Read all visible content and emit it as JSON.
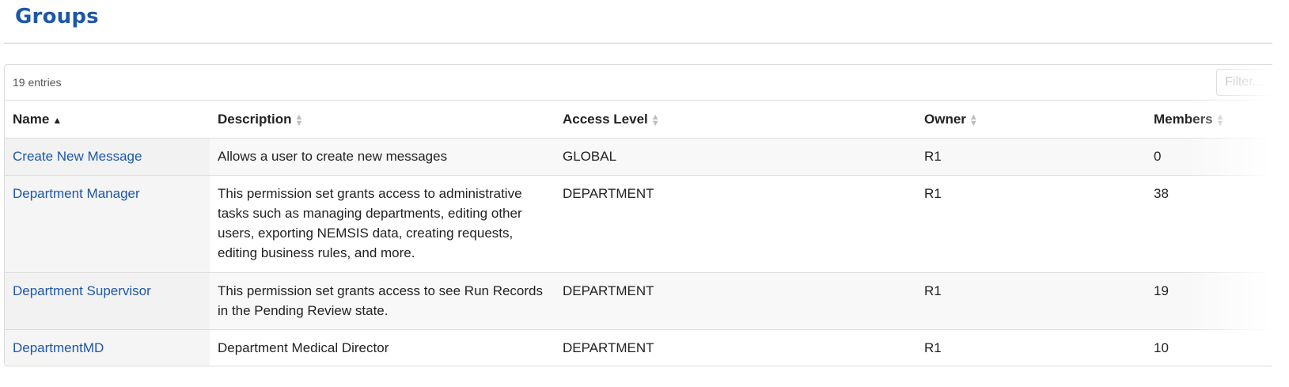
{
  "page": {
    "title": "Groups"
  },
  "toolbar": {
    "entry_count": "19 entries",
    "filter_placeholder": "Filter..."
  },
  "table": {
    "columns": [
      {
        "label": "Name",
        "sort": "ascending"
      },
      {
        "label": "Description",
        "sort": "none"
      },
      {
        "label": "Access Level",
        "sort": "none"
      },
      {
        "label": "Owner",
        "sort": "none"
      },
      {
        "label": "Members",
        "sort": "none"
      }
    ],
    "rows": [
      {
        "name": "Create New Message",
        "description": "Allows a user to create new messages",
        "access_level": "GLOBAL",
        "owner": "R1",
        "members": "0"
      },
      {
        "name": "Department Manager",
        "description": "This permission set grants access to administrative tasks such as managing departments, editing other users, exporting NEMSIS data, creating requests, editing business rules, and more.",
        "access_level": "DEPARTMENT",
        "owner": "R1",
        "members": "38"
      },
      {
        "name": "Department Supervisor",
        "description": "This permission set grants access to see Run Records in the Pending Review state.",
        "access_level": "DEPARTMENT",
        "owner": "R1",
        "members": "19"
      },
      {
        "name": "DepartmentMD",
        "description": "Department Medical Director",
        "access_level": "DEPARTMENT",
        "owner": "R1",
        "members": "10"
      }
    ]
  },
  "colors": {
    "title": "#1d57a8",
    "link": "#1d57a8",
    "border": "#dcdcdc"
  },
  "icons": {
    "sort_ascending": "sort-ascending-icon",
    "sort_unsorted": "sort-unsorted-icon"
  }
}
